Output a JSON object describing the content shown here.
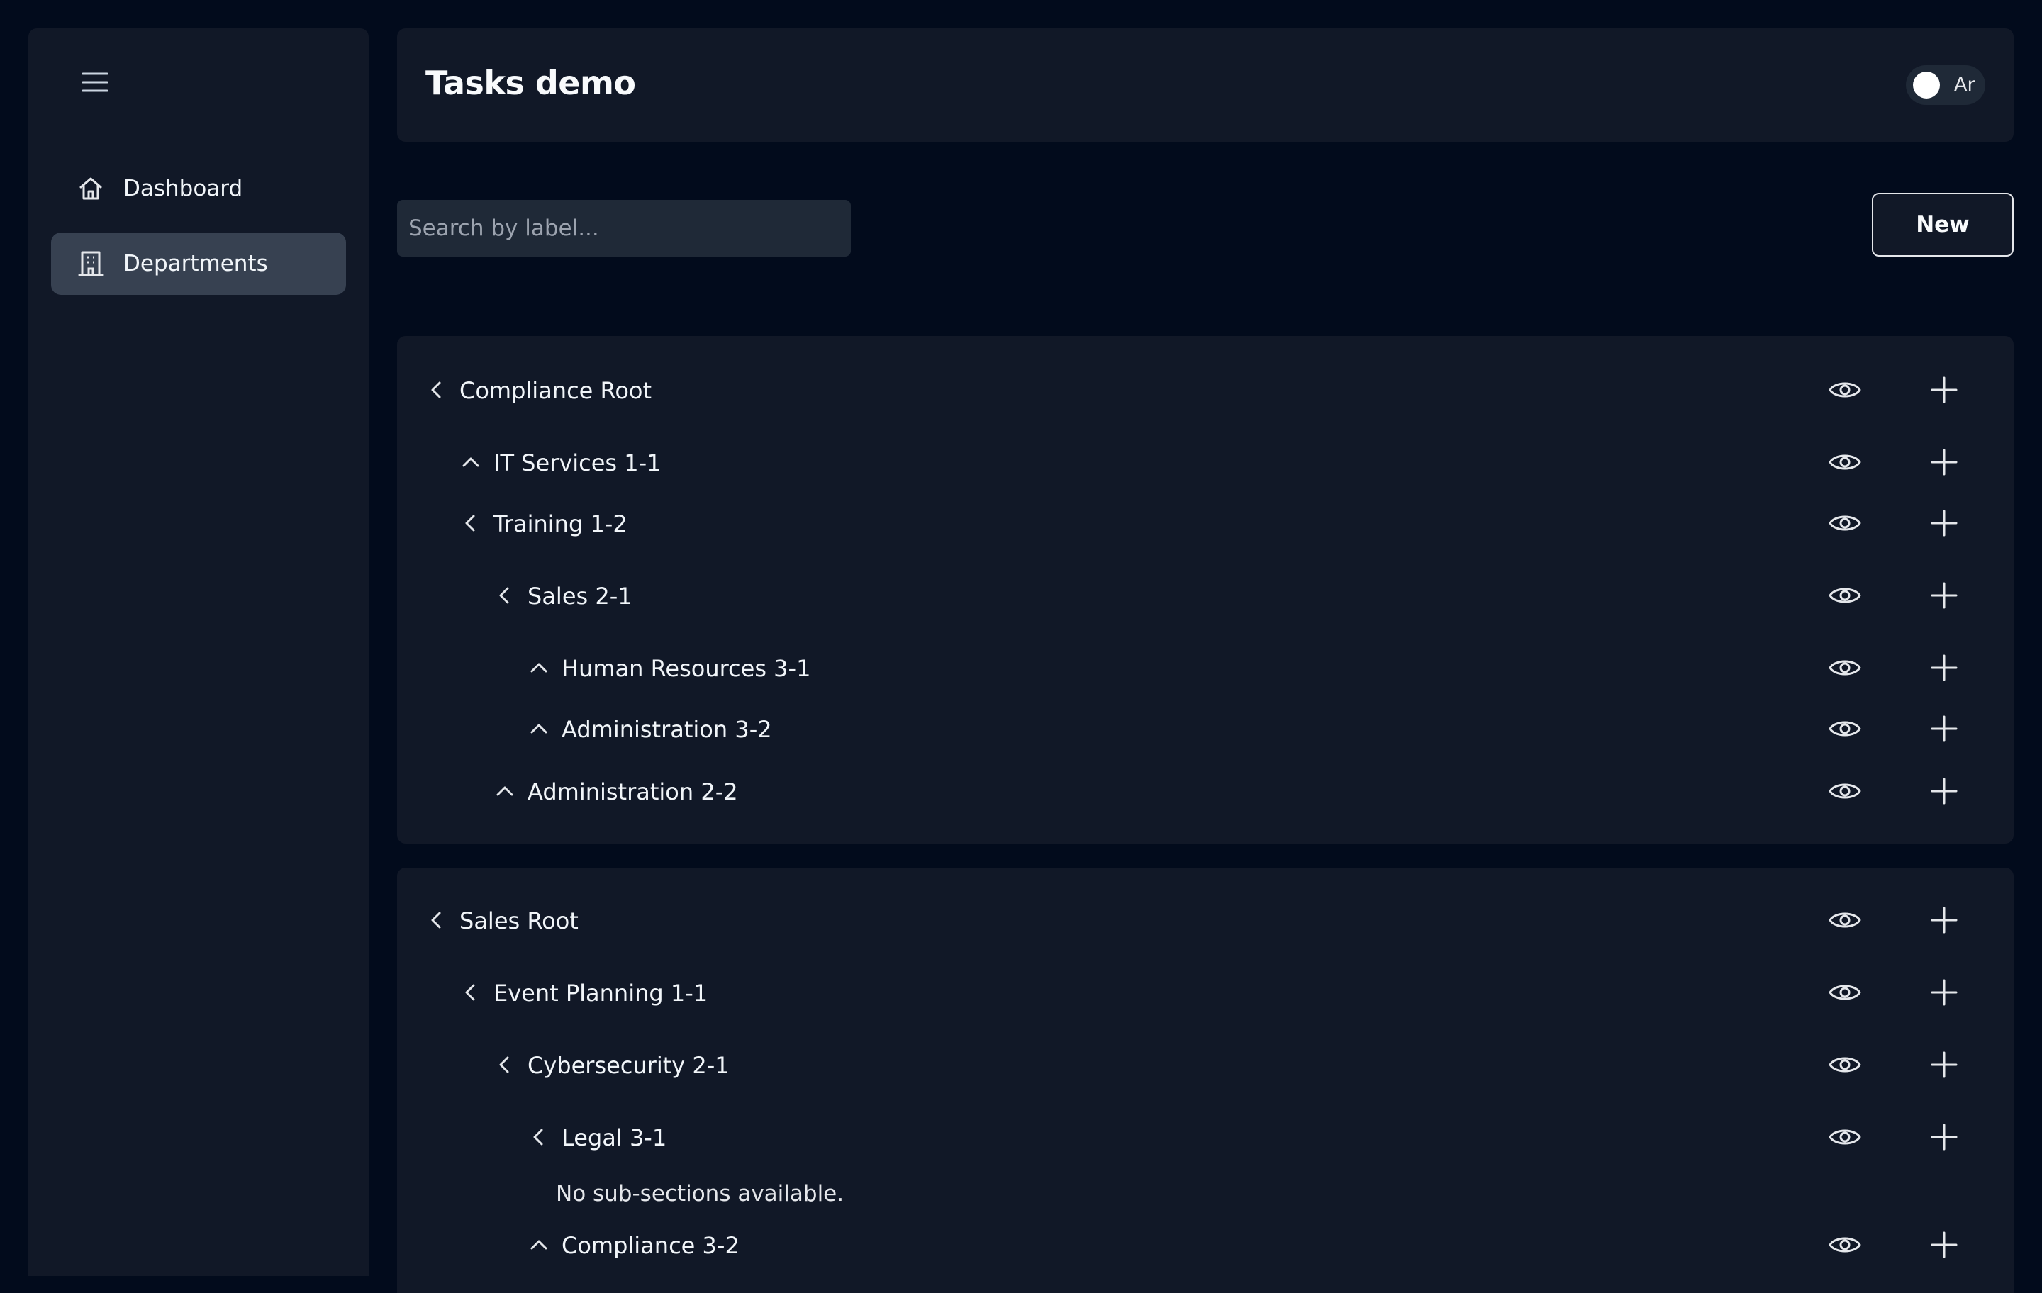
{
  "sidebar": {
    "menu_icon": "menu-icon",
    "items": [
      {
        "label": "Dashboard",
        "icon": "home-icon",
        "active": false
      },
      {
        "label": "Departments",
        "icon": "building-icon",
        "active": true
      }
    ]
  },
  "header": {
    "title": "Tasks demo",
    "language_toggle_label": "Ar"
  },
  "toolbar": {
    "search_placeholder": "Search by label...",
    "new_label": "New"
  },
  "trees": [
    {
      "rows": [
        {
          "label": "Compliance Root",
          "expanded": true
        },
        {
          "label": "IT Services 1-1",
          "expanded": false
        },
        {
          "label": "Training 1-2",
          "expanded": true
        },
        {
          "label": "Sales 2-1",
          "expanded": true
        },
        {
          "label": "Human Resources 3-1",
          "expanded": false
        },
        {
          "label": "Administration 3-2",
          "expanded": false
        },
        {
          "label": "Administration 2-2",
          "expanded": false
        }
      ]
    },
    {
      "rows": [
        {
          "label": "Sales Root",
          "expanded": true
        },
        {
          "label": "Event Planning 1-1",
          "expanded": true
        },
        {
          "label": "Cybersecurity 2-1",
          "expanded": true
        },
        {
          "label": "Legal 3-1",
          "expanded": true
        },
        {
          "label": "Compliance 3-2",
          "expanded": false
        }
      ],
      "empty_message": "No sub-sections available."
    }
  ],
  "colors": {
    "background": "#020b1c",
    "panel": "#111827",
    "active_nav": "#374151",
    "text": "#f1f5f9"
  }
}
